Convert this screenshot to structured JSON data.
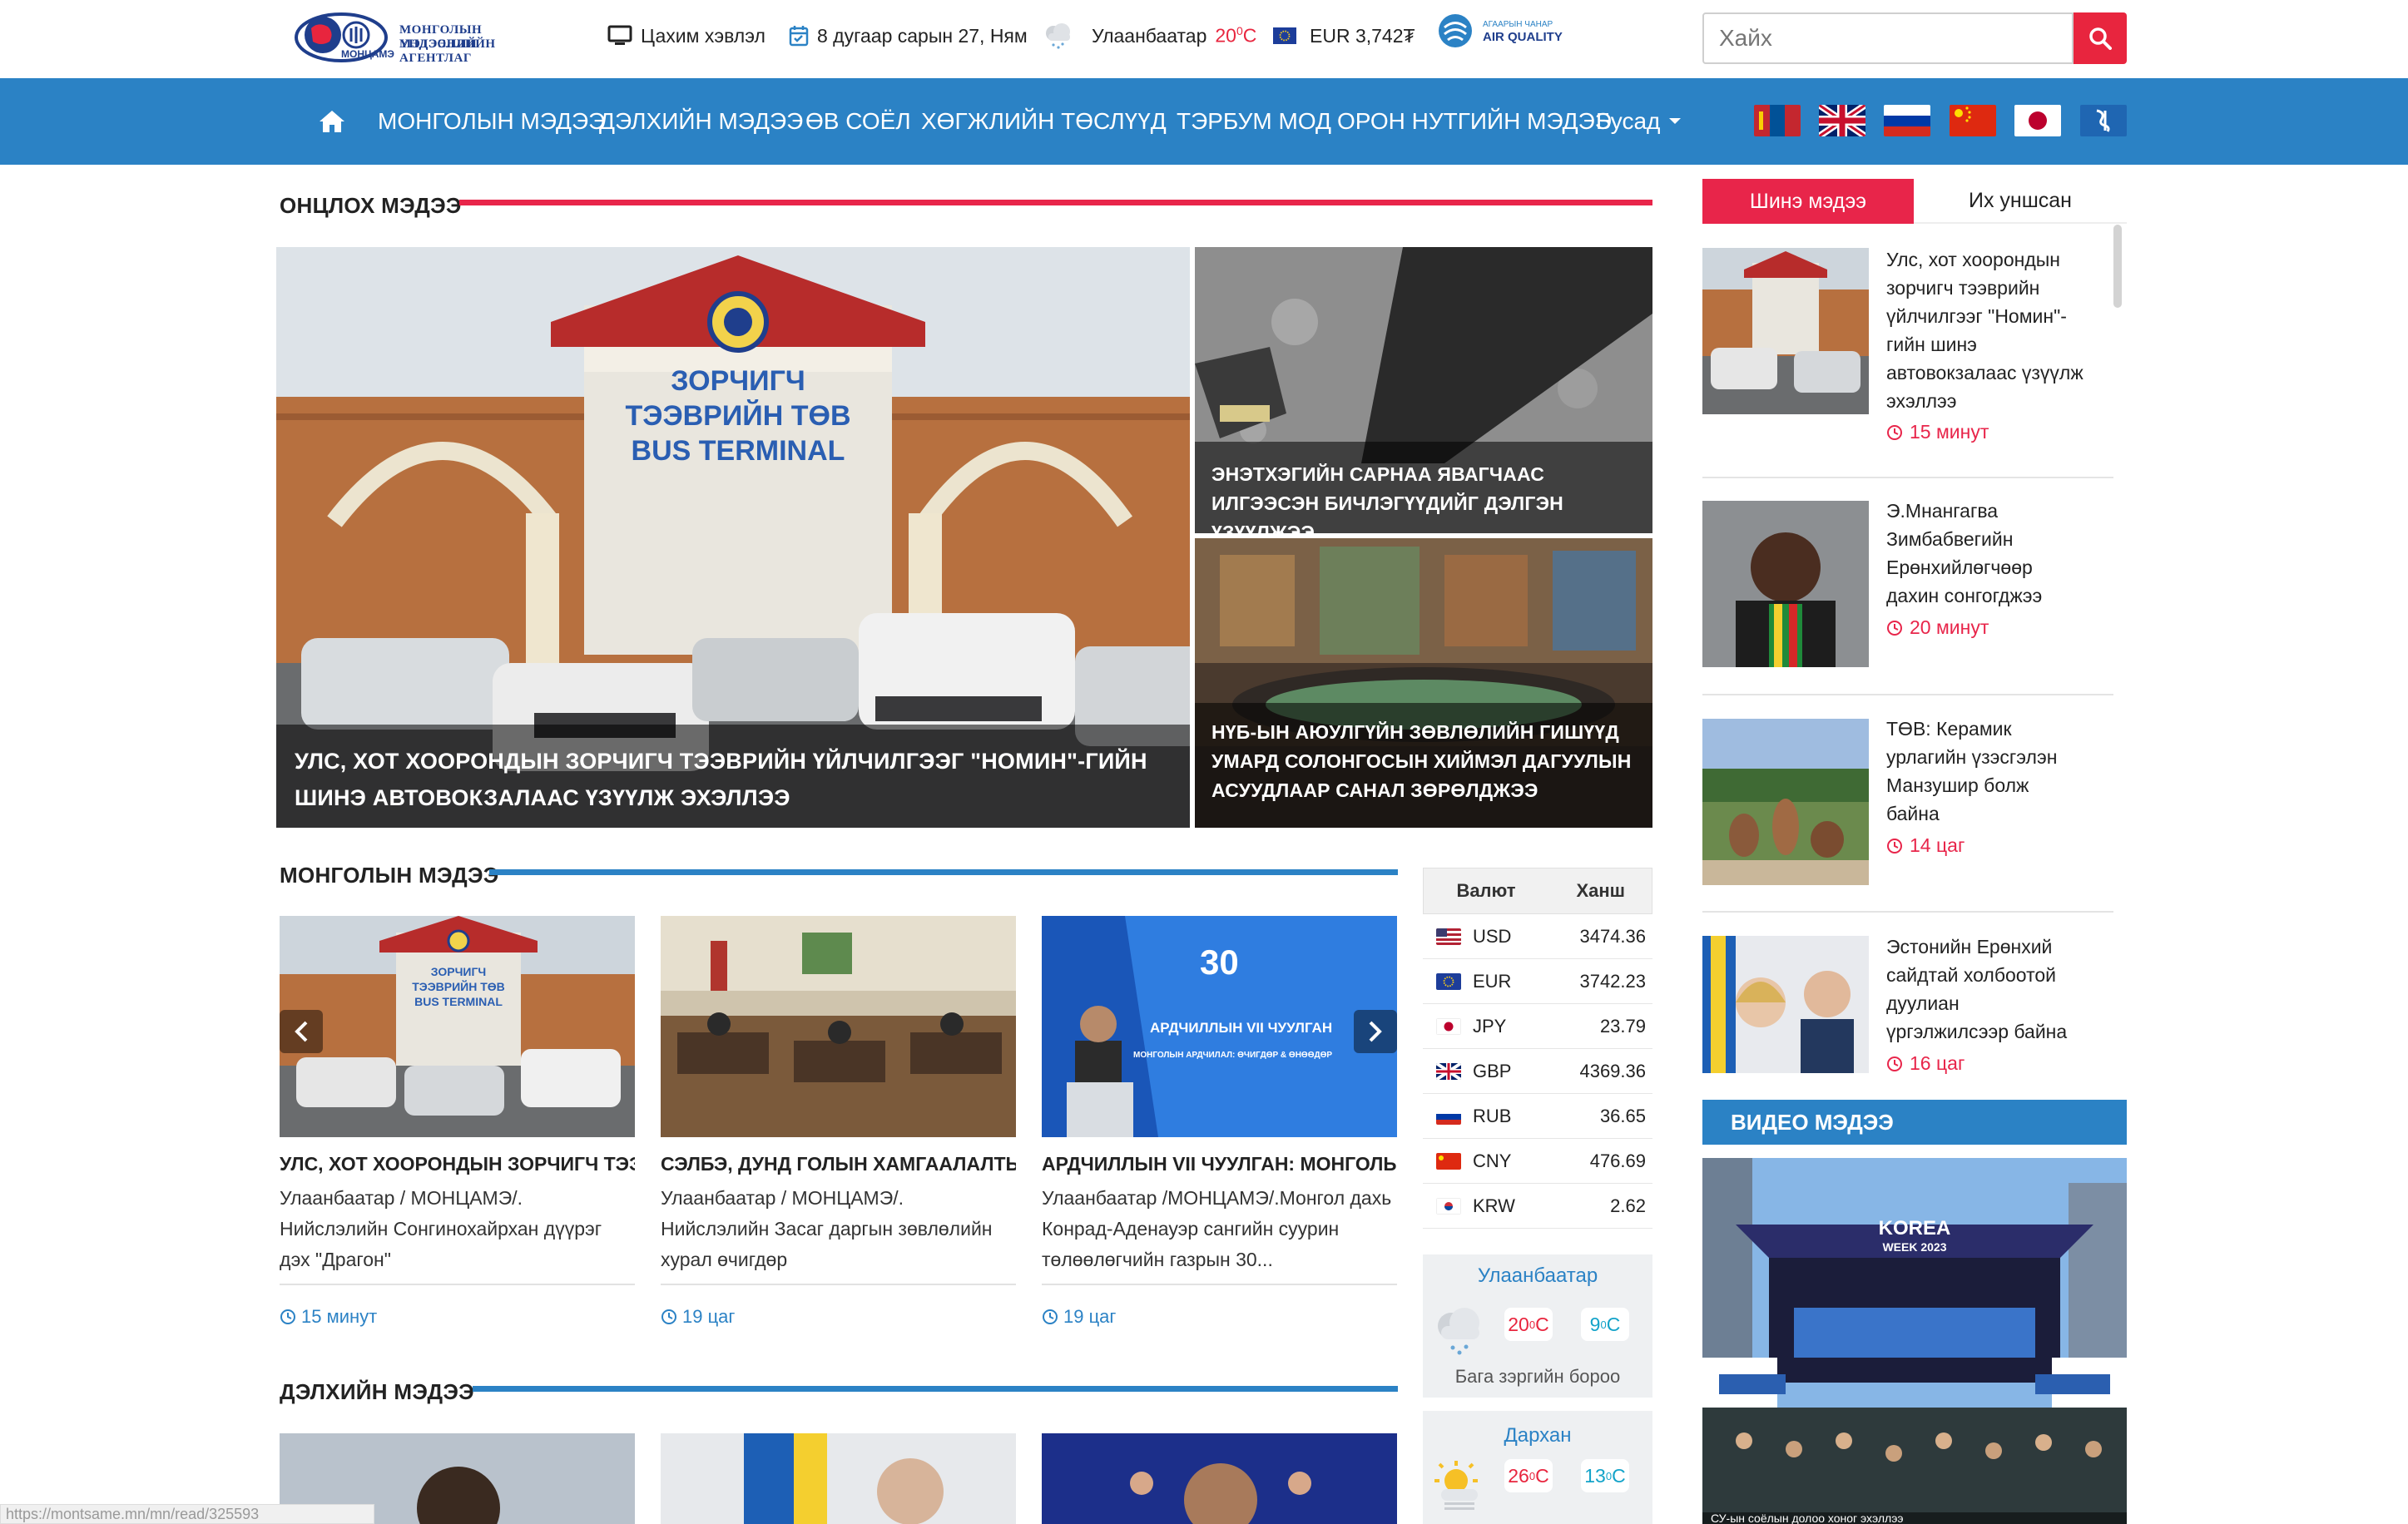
{
  "header": {
    "logo_line1": "МОНГОЛЫН ҮНДЭСНИЙ",
    "logo_line2": "МЭДЭЭЛЛИЙН АГЕНТЛАГ",
    "logo_brand": "МОНЦАМЭ",
    "epaper": "Цахим хэвлэл",
    "date": "8 дугаар сарын 27, Ням",
    "weather_city": "Улаанбаатар",
    "weather_temp": "20",
    "weather_unit": "C",
    "currency": "EUR 3,742₮",
    "air_quality_top": "АГААРЫН ЧАНАР",
    "air_quality": "AIR QUALITY",
    "search_placeholder": "Хайх"
  },
  "nav": {
    "items": [
      "МОНГОЛЫН МЭДЭЭ",
      "ДЭЛХИЙН МЭДЭЭ",
      "ӨВ СОЁЛ",
      "ХӨГЖЛИЙН ТӨСЛҮҮД",
      "ТЭРБУМ МОД",
      "ОРОН НУТГИЙН МЭДЭЭ"
    ],
    "more": "Бусад"
  },
  "featured": {
    "title": "ОНЦЛОХ МЭДЭЭ",
    "main_caption": "УЛС, ХОТ ХООРОНДЫН ЗОРЧИГЧ ТЭЭВРИЙН ҮЙЛЧИЛГЭЭГ \"НОМИН\"-ГИЙН ШИНЭ АВТОВОКЗАЛААС ҮЗҮҮЛЖ ЭХЭЛЛЭЭ",
    "main_sign1": "ЗОРЧИГЧ",
    "main_sign2": "ТЭЭВРИЙН ТӨВ",
    "main_sign3": "BUS TERMINAL",
    "side1_caption": "ЭНЭТХЭГИЙН САРНАА ЯВАГЧААС ИЛГЭЭСЭН БИЧЛЭГҮҮДИЙГ ДЭЛГЭН ҮЗҮҮЛЖЭЭ",
    "side2_caption": "НҮБ-ЫН АЮУЛГҮЙН ЗӨВЛӨЛИЙН ГИШҮҮД УМАРД СОЛОНГОСЫН ХИЙМЭЛ ДАГУУЛЫН АСУУДЛААР САНАЛ ЗӨРӨЛДЖЭЭ"
  },
  "mongolia_news": {
    "title": "МОНГОЛЫН МЭДЭЭ",
    "cards": [
      {
        "title": "УЛС, ХОТ ХООРОНДЫН ЗОРЧИГЧ ТЭЭВРИЙН ҮЙЛЧИЛГЭЭГ",
        "body": "Улаанбаатар / МОНЦАМЭ/. Нийслэлийн Сонгинохайрхан дүүрэг дэх \"Драгон\"",
        "time": "15 минут"
      },
      {
        "title": "СЭЛБЭ, ДУНД ГОЛЫН ХАМГААЛАЛТЫН БҮСЭД",
        "body": "Улаанбаатар / МОНЦАМЭ/. Нийслэлийн Засаг даргын зөвлөлийн хурал өчигдөр",
        "time": "19 цаг"
      },
      {
        "title": "АРДЧИЛЛЫН VII ЧУУЛГАН: МОНГОЛЫН АРДЧИЛАЛ",
        "body": "Улаанбаатар /МОНЦАМЭ/.Монгол дахь Конрад-Аденауэр сангийн суурин төлөөлөгчийн газрын 30...",
        "time": "19 цаг"
      }
    ],
    "card3_banner1": "30",
    "card3_banner2": "АРДЧИЛЛЫН VII ЧУУЛГАН",
    "card3_banner3": "МОНГОЛЫН АРДЧИЛАЛ: ӨЧИГДӨР & ӨНӨӨДӨР"
  },
  "world_news": {
    "title": "ДЭЛХИЙН МЭДЭЭ"
  },
  "currency_table": {
    "col_currency": "Валют",
    "col_rate": "Ханш",
    "rows": [
      {
        "code": "USD",
        "rate": "3474.36"
      },
      {
        "code": "EUR",
        "rate": "3742.23"
      },
      {
        "code": "JPY",
        "rate": "23.79"
      },
      {
        "code": "GBP",
        "rate": "4369.36"
      },
      {
        "code": "RUB",
        "rate": "36.65"
      },
      {
        "code": "CNY",
        "rate": "476.69"
      },
      {
        "code": "KRW",
        "rate": "2.62"
      }
    ]
  },
  "weather_widget": [
    {
      "city": "Улаанбаатар",
      "day": "20",
      "night": "9",
      "unit": "C",
      "desc": "Бага зэргийн бороо"
    },
    {
      "city": "Дархан",
      "day": "26",
      "night": "13",
      "unit": "C"
    }
  ],
  "sidebar": {
    "tab_new": "Шинэ мэдээ",
    "tab_popular": "Их уншсан",
    "items": [
      {
        "text": "Улс, хот хоорондын зорчигч тээврийн үйлчилгээг \"Номин\"-гийн шинэ автовокзалаас үзүүлж эхэллээ",
        "time": "15 минут"
      },
      {
        "text": "Э.Мнангагва Зимбабвегийн Ерөнхийлөгчөөр дахин сонгогджээ",
        "time": "20 минут"
      },
      {
        "text": "ТӨВ: Керамик урлагийн үзэсгэлэн Манзушир болж байна",
        "time": "14 цаг"
      },
      {
        "text": "Эстонийн Ерөнхий сайдтай холбоотой дуулиан үргэлжилсээр байна",
        "time": "16 цаг"
      }
    ],
    "video_title": "ВИДЕО МЭДЭЭ",
    "video_banner": "KOREA",
    "video_banner_sub": "WEEK 2023",
    "video_caption": "СУ-ын соёлын долоо хоног эхэллээ"
  },
  "status_url": "https://montsame.mn/mn/read/325593",
  "colors": {
    "brand_blue": "#2b82c5",
    "accent_red": "#e8253e",
    "pink": "#e8254a"
  }
}
